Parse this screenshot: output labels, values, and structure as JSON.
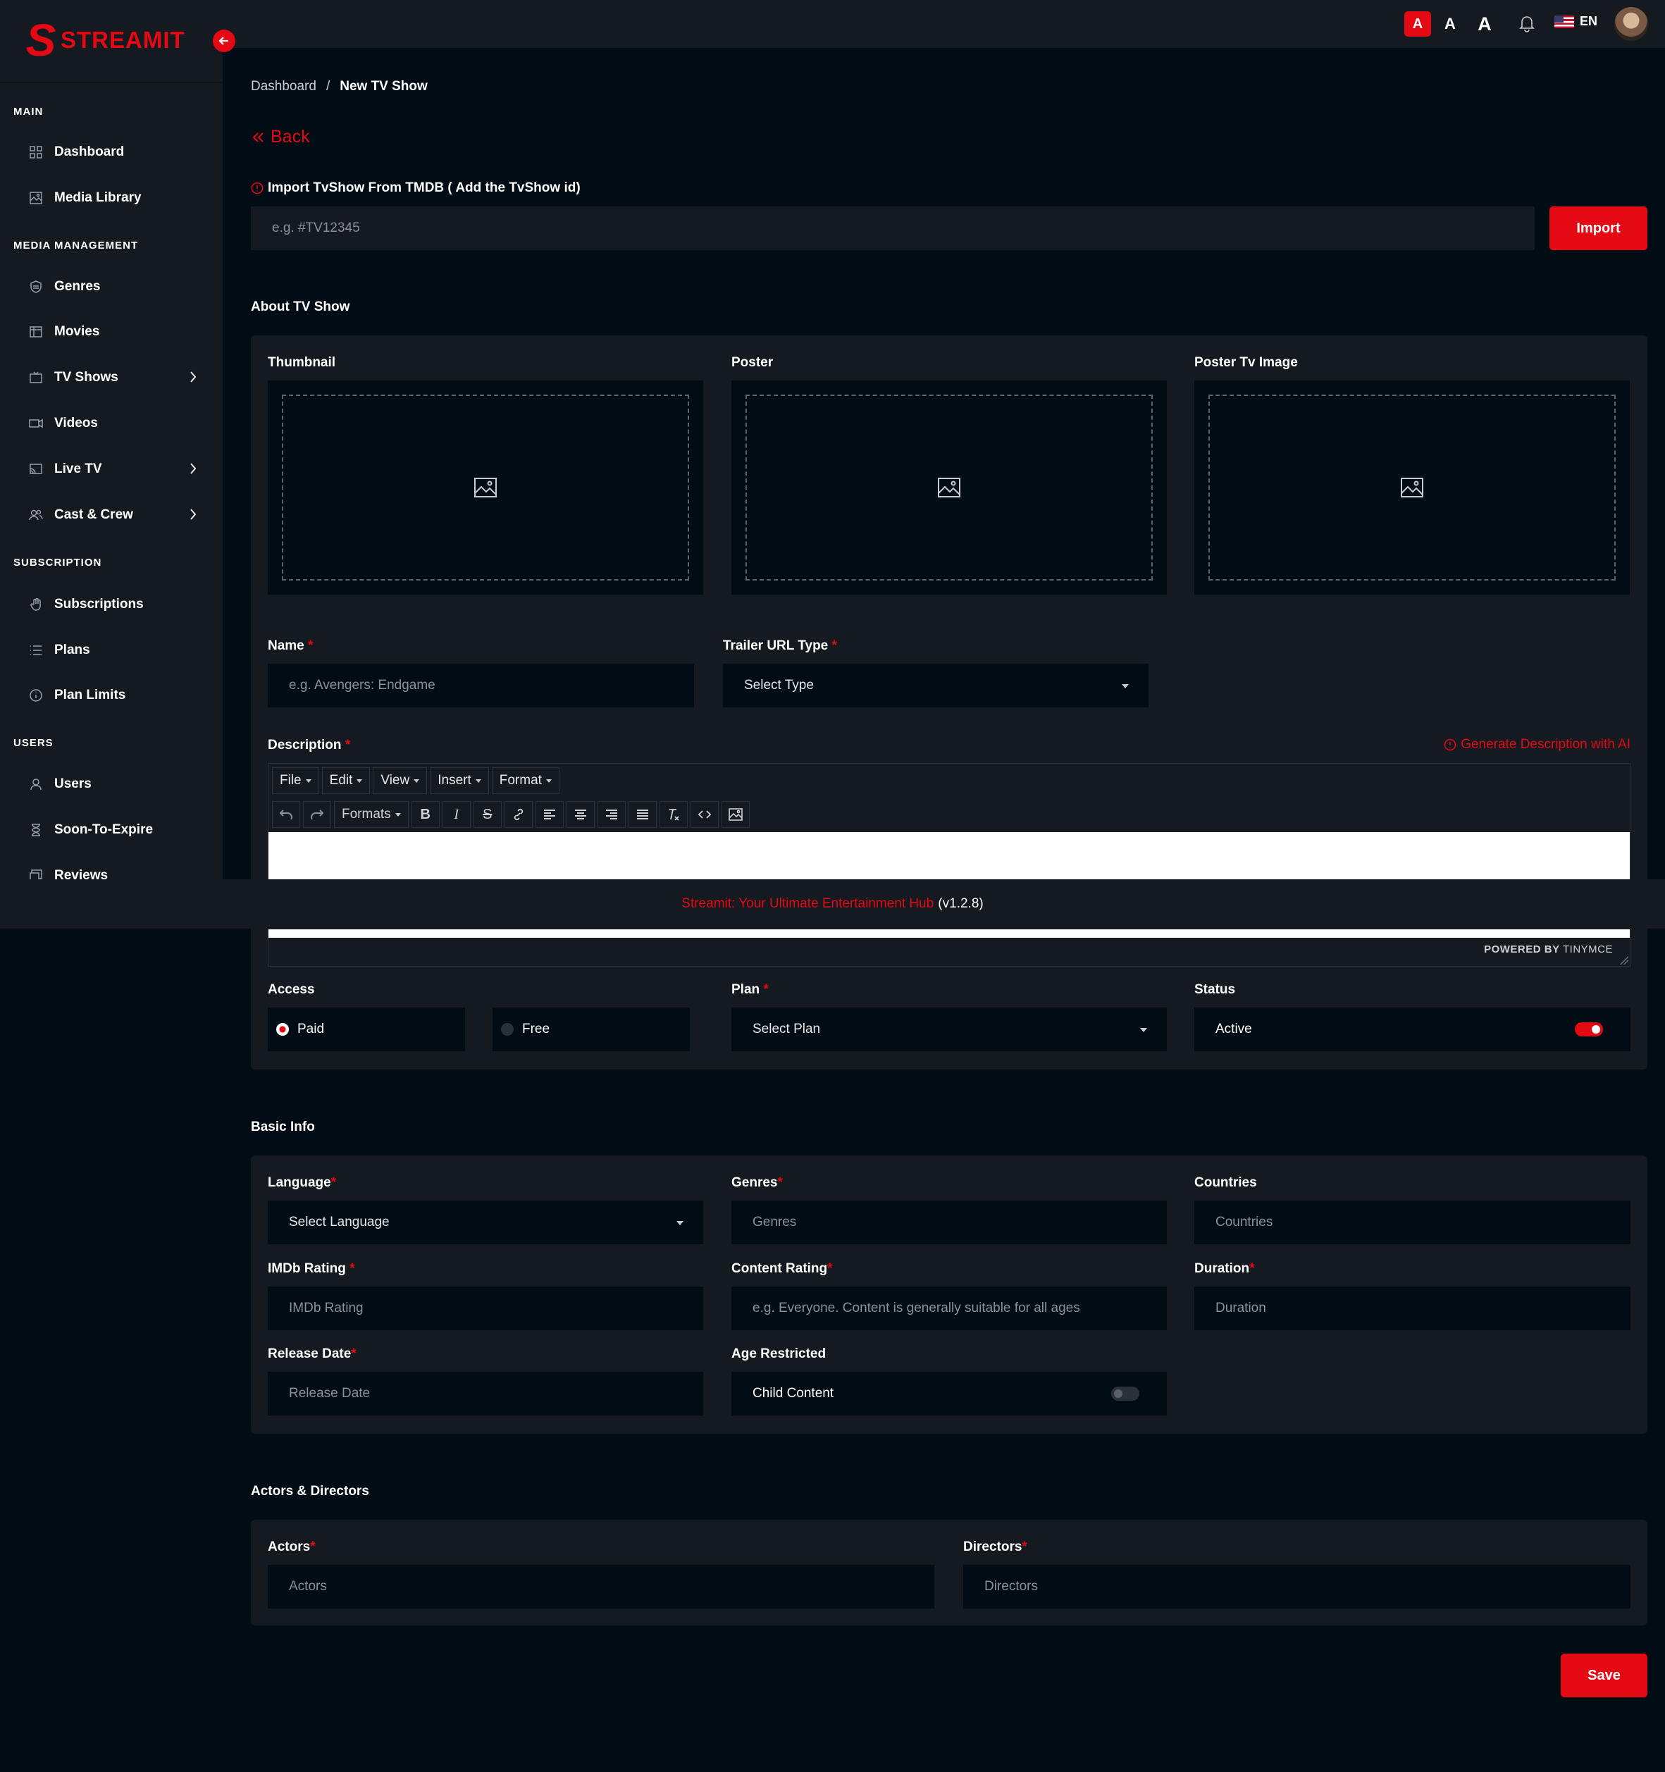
{
  "brand": {
    "name": "STREAMIT",
    "letter": "S"
  },
  "topbar": {
    "font_small": "A",
    "font_medium": "A",
    "font_large": "A",
    "language": "EN"
  },
  "sidebar": {
    "sections": [
      {
        "title": "MAIN"
      },
      {
        "title": "MEDIA MANAGEMENT"
      },
      {
        "title": "SUBSCRIPTION"
      },
      {
        "title": "USERS"
      }
    ],
    "items": [
      {
        "label": "Dashboard",
        "icon": "grid-icon"
      },
      {
        "label": "Media Library",
        "icon": "image-icon"
      },
      {
        "label": "Genres",
        "icon": "shield-icon"
      },
      {
        "label": "Movies",
        "icon": "film-icon"
      },
      {
        "label": "TV Shows",
        "icon": "tv-icon"
      },
      {
        "label": "Videos",
        "icon": "video-icon"
      },
      {
        "label": "Live TV",
        "icon": "cast-icon"
      },
      {
        "label": "Cast & Crew",
        "icon": "people-icon"
      },
      {
        "label": "Subscriptions",
        "icon": "hand-icon"
      },
      {
        "label": "Plans",
        "icon": "list-icon"
      },
      {
        "label": "Plan Limits",
        "icon": "info-icon"
      },
      {
        "label": "Users",
        "icon": "user-icon"
      },
      {
        "label": "Soon-To-Expire",
        "icon": "hourglass-icon"
      },
      {
        "label": "Reviews",
        "icon": "review-icon"
      }
    ]
  },
  "breadcrumb": {
    "parent": "Dashboard",
    "separator": "/",
    "current": "New TV Show"
  },
  "back_label": "Back",
  "import": {
    "label": "Import TvShow From TMDB ( Add the TvShow id)",
    "placeholder": "e.g. #TV12345",
    "button": "Import"
  },
  "about": {
    "title": "About TV Show",
    "thumbnail_label": "Thumbnail",
    "poster_label": "Poster",
    "poster_tv_label": "Poster Tv Image",
    "name_label": "Name",
    "name_placeholder": "e.g. Avengers: Endgame",
    "trailer_label": "Trailer URL Type",
    "trailer_value": "Select Type",
    "description_label": "Description",
    "ai_link": "Generate Description with AI",
    "editor_menu": [
      "File",
      "Edit",
      "View",
      "Insert",
      "Format"
    ],
    "editor_formats": "Formats",
    "powered_by": "POWERED BY",
    "powered_name": "TINYMCE",
    "access_label": "Access",
    "access_paid": "Paid",
    "access_free": "Free",
    "plan_label": "Plan",
    "plan_value": "Select Plan",
    "status_label": "Status",
    "status_value": "Active",
    "required_mark": "*"
  },
  "footer": {
    "brand_text": "Streamit: Your Ultimate Entertainment Hub",
    "version": "(v1.2.8)"
  },
  "basic": {
    "title": "Basic Info",
    "language_label": "Language",
    "language_value": "Select Language",
    "genres_label": "Genres",
    "genres_placeholder": "Genres",
    "countries_label": "Countries",
    "countries_placeholder": "Countries",
    "imdb_label": "IMDb Rating",
    "imdb_placeholder": "IMDb Rating",
    "content_rating_label": "Content Rating",
    "content_rating_placeholder": "e.g. Everyone. Content is generally suitable for all ages",
    "duration_label": "Duration",
    "duration_placeholder": "Duration",
    "release_label": "Release Date",
    "release_placeholder": "Release Date",
    "age_label": "Age Restricted",
    "age_value": "Child Content"
  },
  "people": {
    "title": "Actors & Directors",
    "actors_label": "Actors",
    "actors_placeholder": "Actors",
    "directors_label": "Directors",
    "directors_placeholder": "Directors"
  },
  "save_button": "Save",
  "colors": {
    "accent": "#e50914",
    "background": "#020c14",
    "panel": "#141a20"
  }
}
